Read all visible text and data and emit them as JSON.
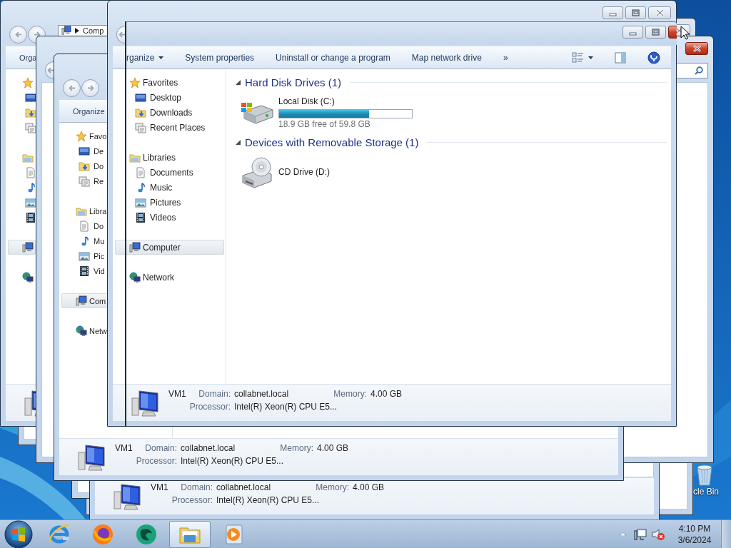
{
  "desktop": {
    "icons": [
      {
        "kind": "recycle_bin",
        "label": "cle Bin"
      }
    ]
  },
  "windows": [
    {
      "kind": "blank"
    },
    {
      "kind": "blank",
      "controls": [
        {
          "kind": "close",
          "hot": false
        }
      ]
    },
    {
      "kind": "blank"
    },
    {
      "kind": "explorer",
      "details": {
        "kind": "computer",
        "name": "VM1",
        "domain_label": "Domain:",
        "domain": "collabnet.local",
        "memory_label": "Memory:",
        "memory": "4.00 GB",
        "processor_label": "Processor:",
        "processor": "Intel(R) Xeon(R) CPU E5..."
      }
    },
    {
      "kind": "explorer",
      "nav_buttons": [
        {
          "kind": "back"
        },
        {
          "kind": "forward"
        }
      ],
      "address": {
        "text": "Comp"
      },
      "toolbar": [
        {
          "kind": "command",
          "label": "Orga"
        }
      ],
      "nav": [
        {
          "kind": "favorites",
          "selected": false,
          "children": [
            {
              "kind": "desktop",
              "selected": false
            },
            {
              "kind": "downloads",
              "selected": false
            },
            {
              "kind": "recent",
              "selected": false
            }
          ]
        },
        {
          "kind": "libraries",
          "selected": false,
          "children": [
            {
              "kind": "documents",
              "selected": false
            },
            {
              "kind": "music",
              "selected": false
            },
            {
              "kind": "pictures",
              "selected": false
            },
            {
              "kind": "videos",
              "selected": false
            }
          ]
        },
        {
          "kind": "computer",
          "selected": true
        },
        {
          "kind": "network",
          "selected": false
        }
      ],
      "details": {
        "kind": "computer"
      }
    },
    {
      "kind": "blank",
      "controls": [
        {
          "kind": "close",
          "hot": true
        }
      ],
      "nav_buttons": [
        {
          "kind": "back"
        }
      ],
      "search": true
    },
    {
      "kind": "explorer",
      "nav_buttons": [
        {
          "kind": "back"
        },
        {
          "kind": "forward"
        }
      ],
      "toolbar": [
        {
          "kind": "command",
          "label": "Organize"
        }
      ],
      "nav": [
        {
          "kind": "favorites",
          "label": "Favo",
          "selected": false,
          "children": [
            {
              "kind": "desktop",
              "label": "De",
              "selected": false
            },
            {
              "kind": "downloads",
              "label": "Do",
              "selected": false
            },
            {
              "kind": "recent",
              "label": "Re",
              "selected": false
            }
          ]
        },
        {
          "kind": "libraries",
          "label": "Libra",
          "selected": false,
          "children": [
            {
              "kind": "documents",
              "label": "Do",
              "selected": false
            },
            {
              "kind": "music",
              "label": "Mu",
              "selected": false
            },
            {
              "kind": "pictures",
              "label": "Pic",
              "selected": false
            },
            {
              "kind": "videos",
              "label": "Vid",
              "selected": false
            }
          ]
        },
        {
          "kind": "computer",
          "label": "Com",
          "selected": true
        },
        {
          "kind": "network",
          "label": "Netw",
          "selected": false
        }
      ],
      "details": {
        "kind": "computer",
        "name": "VM1",
        "domain_label": "Domain:",
        "domain": "collabnet.local",
        "memory_label": "Memory:",
        "memory": "4.00 GB",
        "processor_label": "Processor:",
        "processor": "Intel(R) Xeon(R) CPU E5..."
      }
    },
    {
      "kind": "explorer",
      "controls": [
        {
          "kind": "minimize",
          "hot": false
        },
        {
          "kind": "maximize",
          "hot": false
        },
        {
          "kind": "close",
          "hot": false
        }
      ],
      "nav_buttons": [
        {
          "kind": "back"
        }
      ],
      "toolbar": [
        {
          "kind": "menu",
          "label": "rganize"
        },
        {
          "kind": "command",
          "label": "System properties"
        },
        {
          "kind": "command",
          "label": "Uninstall or change a program"
        },
        {
          "kind": "command",
          "label": "Map network drive"
        },
        {
          "kind": "more",
          "label": "»"
        },
        {
          "kind": "views"
        },
        {
          "kind": "pane"
        },
        {
          "kind": "help"
        }
      ],
      "nav": [
        {
          "kind": "favorites",
          "label": "Favorites",
          "selected": false,
          "children": [
            {
              "kind": "desktop",
              "label": "Desktop",
              "selected": false
            },
            {
              "kind": "downloads",
              "label": "Downloads",
              "selected": false
            },
            {
              "kind": "recent",
              "label": "Recent Places",
              "selected": false
            }
          ]
        },
        {
          "kind": "libraries",
          "label": "Libraries",
          "selected": false,
          "children": [
            {
              "kind": "documents",
              "label": "Documents",
              "selected": false
            },
            {
              "kind": "music",
              "label": "Music",
              "selected": false
            },
            {
              "kind": "pictures",
              "label": "Pictures",
              "selected": false
            },
            {
              "kind": "videos",
              "label": "Videos",
              "selected": false
            }
          ]
        },
        {
          "kind": "computer",
          "label": "Computer",
          "selected": true
        },
        {
          "kind": "network",
          "label": "Network",
          "selected": false
        }
      ],
      "content": [
        {
          "title": "Hard Disk Drives (1)",
          "expanded": true,
          "drives": [
            {
              "kind": "hdd",
              "name": "Local Disk (C:)",
              "level": 0.68,
              "free": "18.9 GB free of 59.8 GB"
            }
          ]
        },
        {
          "title": "Devices with Removable Storage (1)",
          "expanded": true,
          "drives": [
            {
              "kind": "cd",
              "name": "CD Drive (D:)"
            }
          ]
        }
      ],
      "details": {
        "kind": "computer",
        "name": "VM1",
        "domain_label": "Domain:",
        "domain": "collabnet.local",
        "memory_label": "Memory:",
        "memory": "4.00 GB",
        "processor_label": "Processor:",
        "processor": "Intel(R) Xeon(R) CPU E5..."
      }
    },
    {
      "kind": "ghost",
      "controls": [
        {
          "kind": "minimize",
          "hot": false
        },
        {
          "kind": "maximize",
          "hot": false
        },
        {
          "kind": "close",
          "hot": true
        }
      ]
    }
  ],
  "taskbar": {
    "apps": [
      {
        "kind": "ie",
        "selected": false
      },
      {
        "kind": "firefox",
        "selected": false
      },
      {
        "kind": "app",
        "selected": false
      },
      {
        "kind": "explorer",
        "selected": true
      },
      {
        "kind": "media",
        "selected": false
      }
    ],
    "tray": [
      {
        "kind": "show_hidden"
      },
      {
        "kind": "network"
      },
      {
        "kind": "volume",
        "muted": true
      }
    ],
    "clock": {
      "time": "4:10 PM",
      "date": "3/6/2024"
    }
  }
}
